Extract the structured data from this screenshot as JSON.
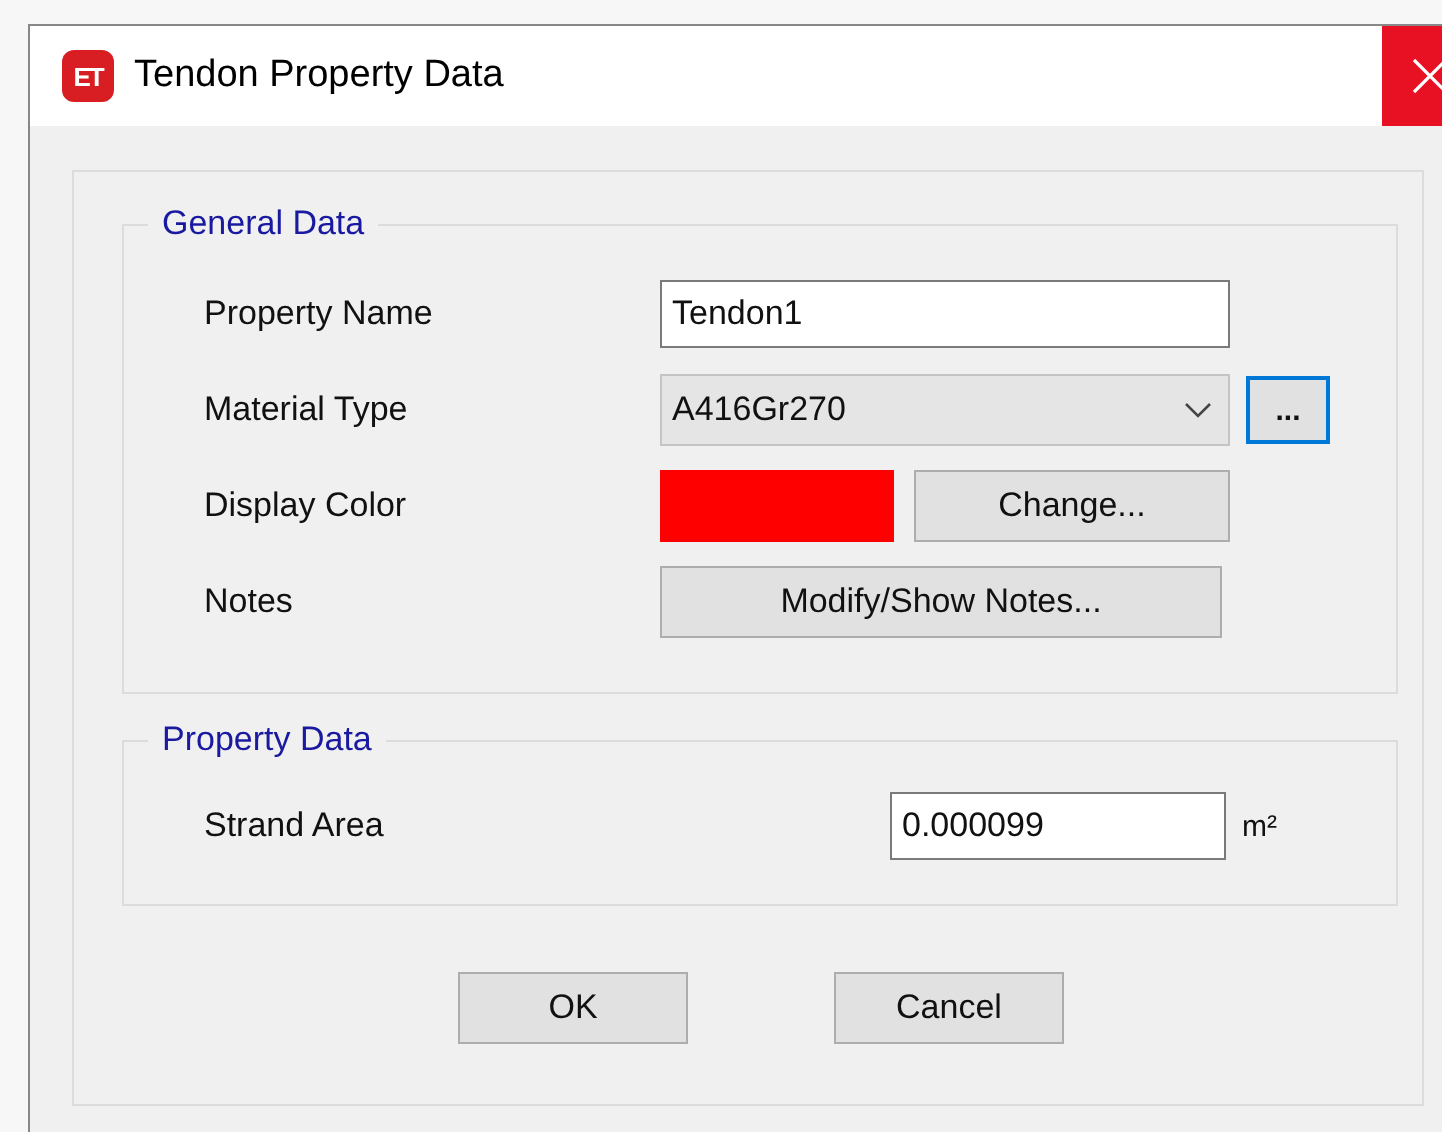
{
  "window": {
    "app_icon": "ET",
    "title": "Tendon Property Data"
  },
  "general_data": {
    "legend": "General Data",
    "property_name": {
      "label": "Property Name",
      "value": "Tendon1"
    },
    "material_type": {
      "label": "Material Type",
      "value": "A416Gr270",
      "browse_button": "...",
      "browse_focused": true
    },
    "display_color": {
      "label": "Display Color",
      "color": "#ff0000",
      "button": "Change..."
    },
    "notes": {
      "label": "Notes",
      "button": "Modify/Show Notes..."
    }
  },
  "property_data": {
    "legend": "Property Data",
    "strand_area": {
      "label": "Strand Area",
      "value": "0.000099",
      "unit": "m²"
    }
  },
  "buttons": [
    "OK",
    "Cancel"
  ]
}
